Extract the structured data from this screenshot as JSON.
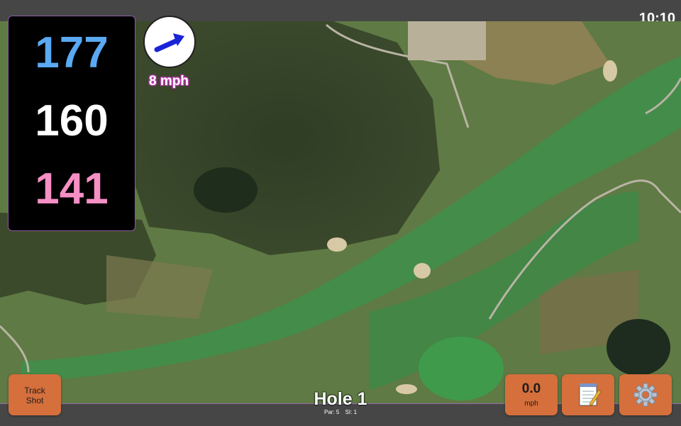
{
  "status_bar": {
    "time": "10:10"
  },
  "distances": {
    "back": "177",
    "middle": "160",
    "front": "141"
  },
  "wind": {
    "speed": "8 mph",
    "icon": "wind-arrow-icon"
  },
  "hole": {
    "title": "Hole 1",
    "par": "Par: 5",
    "stroke_index": "SI: 1"
  },
  "buttons": {
    "track_shot": {
      "line1": "Track",
      "line2": "Shot"
    },
    "speed": {
      "value": "0.0",
      "unit": "mph"
    },
    "notes": {
      "icon": "notepad-icon"
    },
    "settings": {
      "icon": "gear-icon"
    }
  },
  "colors": {
    "back_distance": "#5aa9f2",
    "middle_distance": "#ffffff",
    "front_distance": "#f58fc4",
    "button_orange": "#d56f3c",
    "accent_purple": "#9a6aa6"
  }
}
